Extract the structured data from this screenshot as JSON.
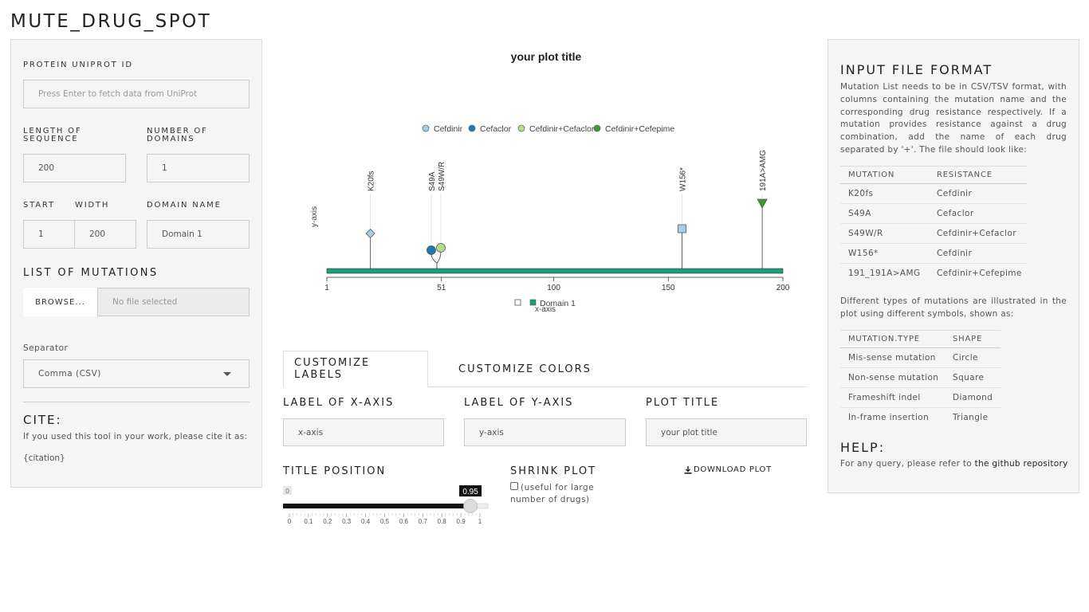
{
  "app": {
    "title": "MUTE_DRUG_SPOT"
  },
  "left": {
    "uniprot_label": "PROTEIN UNIPROT ID",
    "uniprot_placeholder": "Press Enter to fetch data from UniProt",
    "length_label": "LENGTH OF SEQUENCE",
    "length_value": "200",
    "domains_label": "NUMBER OF DOMAINS",
    "domains_value": "1",
    "start_label": "START",
    "start_value": "1",
    "width_label": "WIDTH",
    "width_value": "200",
    "domain_name_label": "DOMAIN NAME",
    "domain_name_value": "Domain 1",
    "mutations_heading": "LIST OF MUTATIONS",
    "browse_label": "BROWSE...",
    "file_status": "No file selected",
    "separator_label": "Separator",
    "separator_value": "Comma (CSV)",
    "cite_heading": "CITE:",
    "cite_text": "If you used this tool in your work, please cite it as:",
    "citation": "{citation}"
  },
  "chart_data": {
    "type": "scatter",
    "title": "your plot title",
    "xlabel": "x-axis",
    "ylabel": "y-axis",
    "xlim": [
      1,
      200
    ],
    "x_ticks": [
      "1",
      "51",
      "100",
      "150",
      "200"
    ],
    "x_tick_values": [
      1,
      51,
      100,
      150,
      200
    ],
    "legend": [
      {
        "name": "Cefdinir",
        "color": "#a6cee3"
      },
      {
        "name": "Cefaclor",
        "color": "#1f78b4"
      },
      {
        "name": "Cefdinir+Cefaclor",
        "color": "#b2df8a"
      },
      {
        "name": "Cefdinir+Cefepime",
        "color": "#33a02c"
      }
    ],
    "domain_legend": "Domain 1",
    "domain": {
      "start": 1,
      "end": 200,
      "color": "#1a9e77"
    },
    "mutations": [
      {
        "label": "K20fs",
        "pos": 20,
        "drug": "Cefdinir",
        "shape": "diamond",
        "color": "#a6cee3"
      },
      {
        "label": "S49A",
        "pos": 49,
        "drug": "Cefaclor",
        "shape": "circle",
        "color": "#1f78b4"
      },
      {
        "label": "S49W/R",
        "pos": 49,
        "drug": "Cefdinir+Cefaclor",
        "shape": "circle",
        "color": "#b2df8a"
      },
      {
        "label": "W156*",
        "pos": 156,
        "drug": "Cefdinir",
        "shape": "square",
        "color": "#a6cee3"
      },
      {
        "label": "191A>AMG",
        "pos": 191,
        "drug": "Cefdinir+Cefepime",
        "shape": "triangle",
        "color": "#33a02c"
      }
    ]
  },
  "tabs": [
    {
      "label": "CUSTOMIZE LABELS"
    },
    {
      "label": "CUSTOMIZE COLORS"
    }
  ],
  "customize": {
    "xaxis_label": "LABEL OF X-AXIS",
    "xaxis_value": "x-axis",
    "yaxis_label": "LABEL OF Y-AXIS",
    "yaxis_value": "y-axis",
    "plot_title_label": "PLOT TITLE",
    "plot_title_value": "your plot title",
    "title_position_label": "TITLE POSITION",
    "slider": {
      "min": 0,
      "max": 1,
      "value": 0.95,
      "min_label": "0",
      "value_label": "0.95",
      "ticks": [
        "0",
        "0.1",
        "0.2",
        "0.3",
        "0.4",
        "0.5",
        "0.6",
        "0.7",
        "0.8",
        "0.9",
        "1"
      ]
    },
    "shrink_label": "SHRINK PLOT",
    "shrink_hint": "(useful for large number of drugs)",
    "download_label": "DOWNLOAD PLOT"
  },
  "right": {
    "heading": "INPUT FILE FORMAT",
    "intro": "Mutation List needs to be in CSV/TSV format, with columns containing the mutation name and the corresponding drug resistance respectively. If a mutation provides resistance against a drug combination, add the name of each drug separated by '+'. The file should look like:",
    "format_table": {
      "headers": [
        "MUTATION",
        "RESISTANCE"
      ],
      "rows": [
        [
          "K20fs",
          "Cefdinir"
        ],
        [
          "S49A",
          "Cefaclor"
        ],
        [
          "S49W/R",
          "Cefdinir+Cefaclor"
        ],
        [
          "W156*",
          "Cefdinir"
        ],
        [
          "191_191A>AMG",
          "Cefdinir+Cefepime"
        ]
      ]
    },
    "types_text": "Different types of mutations are illustrated in the plot using different symbols, shown as:",
    "types_table": {
      "headers": [
        "MUTATION.TYPE",
        "SHAPE"
      ],
      "rows": [
        [
          "Mis-sense mutation",
          "Circle"
        ],
        [
          "Non-sense mutation",
          "Square"
        ],
        [
          "Frameshift indel",
          "Diamond"
        ],
        [
          "In-frame insertion",
          "Triangle"
        ]
      ]
    },
    "help_heading": "HELP:",
    "help_text": "For any query, please refer to ",
    "help_link": "the github repository"
  }
}
